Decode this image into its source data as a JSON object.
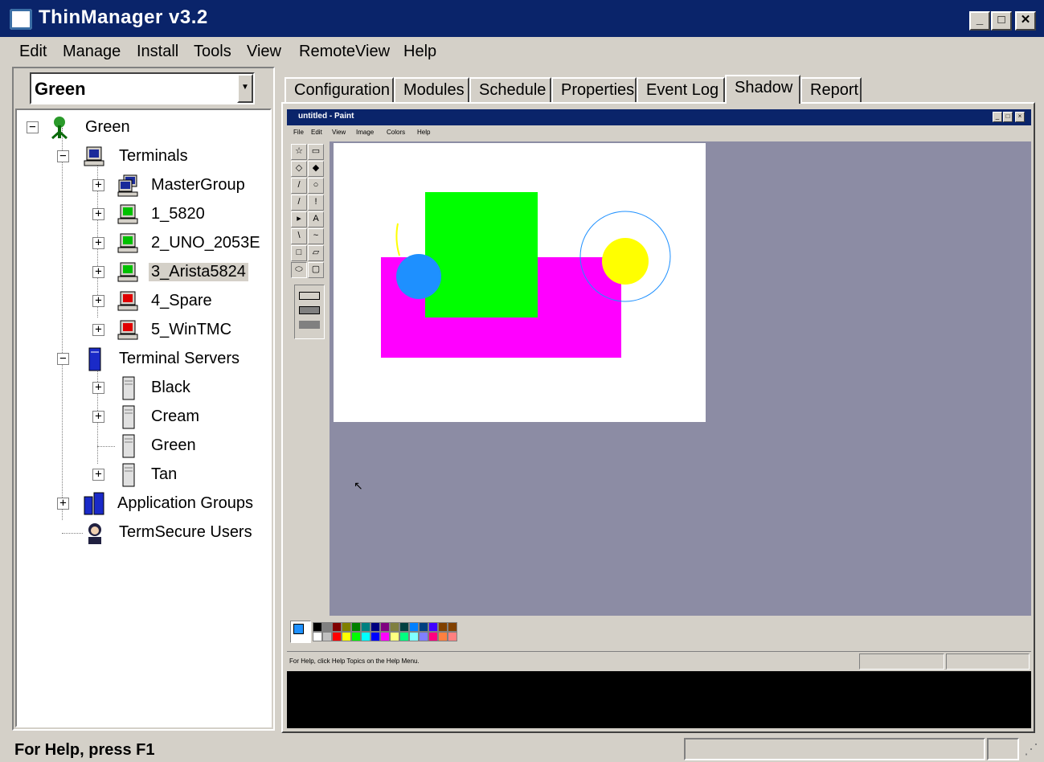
{
  "window": {
    "title": "ThinManager v3.2",
    "min": "_",
    "max": "□",
    "close": "✕"
  },
  "menu": [
    "Edit",
    "Manage",
    "Install",
    "Tools",
    "View",
    "RemoteView",
    "Help"
  ],
  "group_select": {
    "value": "Green"
  },
  "tree": {
    "root": "Green",
    "terminals": "Terminals",
    "terminal_items": [
      "MasterGroup",
      "1_5820",
      "2_UNO_2053E",
      "3_Arista5824",
      "4_Spare",
      "5_WinTMC"
    ],
    "terminal_servers": "Terminal Servers",
    "server_items": [
      "Black",
      "Cream",
      "Green",
      "Tan"
    ],
    "application_groups": "Application Groups",
    "termsecure_users": "TermSecure Users"
  },
  "tabs": [
    "Configuration",
    "Modules",
    "Schedule",
    "Properties",
    "Event Log",
    "Shadow",
    "Report"
  ],
  "active_tab": "Shadow",
  "paint": {
    "title": "untitled - Paint",
    "menu": [
      "File",
      "Edit",
      "View",
      "Image",
      "Colors",
      "Help"
    ],
    "status": "For Help, click Help Topics on the Help Menu."
  },
  "status_bar": {
    "text": "For Help, press F1"
  },
  "colors": {
    "titlebar": "#0a246a",
    "paint_workspace": "#8c8ca4",
    "shape_green": "#00ff00",
    "shape_magenta": "#ff00ff",
    "shape_blue_circle": "#1e90ff",
    "shape_yellow": "#ffff00"
  }
}
